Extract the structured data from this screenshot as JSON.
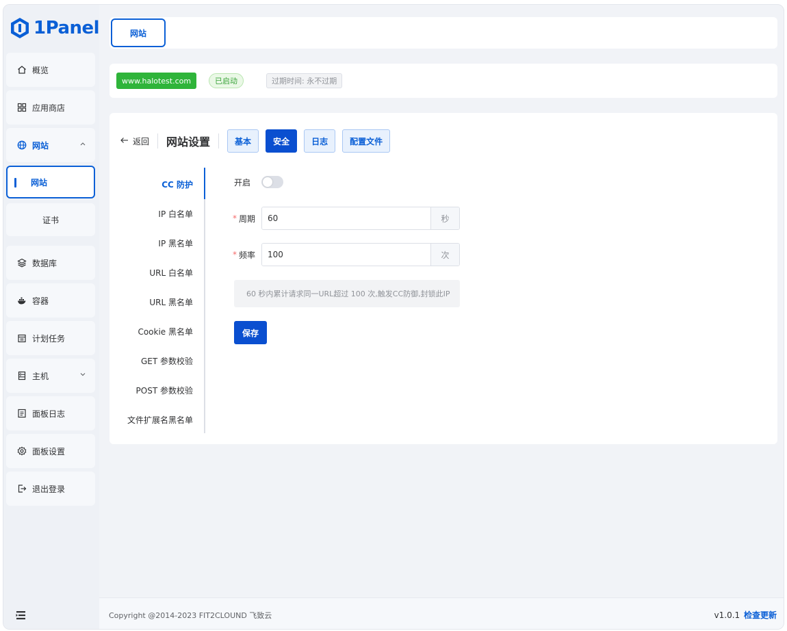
{
  "brand": {
    "name": "1Panel"
  },
  "sidebar": {
    "items": [
      {
        "label": "概览",
        "icon": "home-icon"
      },
      {
        "label": "应用商店",
        "icon": "grid-icon"
      },
      {
        "label": "网站",
        "icon": "globe-icon"
      },
      {
        "label": "数据库",
        "icon": "layers-icon"
      },
      {
        "label": "容器",
        "icon": "docker-icon"
      },
      {
        "label": "计划任务",
        "icon": "calendar-icon"
      },
      {
        "label": "主机",
        "icon": "server-icon"
      },
      {
        "label": "面板日志",
        "icon": "log-icon"
      },
      {
        "label": "面板设置",
        "icon": "gear-icon"
      },
      {
        "label": "退出登录",
        "icon": "logout-icon"
      }
    ],
    "sub_items": [
      {
        "label": "网站"
      },
      {
        "label": "证书"
      }
    ]
  },
  "tabs": {
    "main_label": "网站"
  },
  "site_info": {
    "domain": "www.halotest.com",
    "status": "已启动",
    "expire": "过期时间: 永不过期"
  },
  "settings": {
    "back_label": "返回",
    "title": "网站设置",
    "segments": [
      "基本",
      "安全",
      "日志",
      "配置文件"
    ],
    "active_segment": "安全",
    "side_menu": [
      "CC 防护",
      "IP 白名单",
      "IP 黑名单",
      "URL 白名单",
      "URL 黑名单",
      "Cookie 黑名单",
      "GET 参数校验",
      "POST 参数校验",
      "文件扩展名黑名单"
    ],
    "active_menu": "CC 防护",
    "form": {
      "enable_label": "开启",
      "enable_on": false,
      "period_label": "周期",
      "period_value": "60",
      "period_unit": "秒",
      "freq_label": "频率",
      "freq_value": "100",
      "freq_unit": "次",
      "required_mark": "*",
      "hint": "60 秒内累计请求同一URL超过 100 次,触发CC防御,封锁此IP",
      "save_label": "保存"
    }
  },
  "footer": {
    "copyright": "Copyright @2014-2023 FIT2CLOUND 飞致云",
    "version": "v1.0.1",
    "update_label": "检查更新"
  },
  "colors": {
    "accent": "#0a5fd6",
    "primary_button": "#0a4fd0",
    "success": "#2fb43a"
  }
}
